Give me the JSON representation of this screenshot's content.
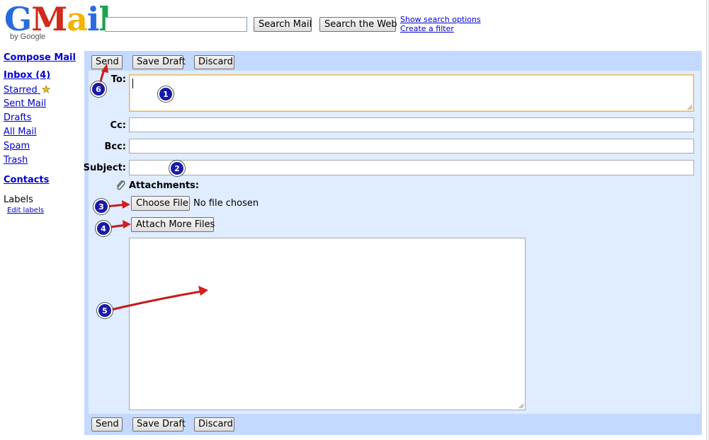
{
  "header": {
    "logo_text": "Gmail",
    "logo_byline": "by Google",
    "search_value": "",
    "search_mail_label": "Search Mail",
    "search_web_label": "Search the Web",
    "show_search_options": "Show search options",
    "create_filter": "Create a filter"
  },
  "nav": {
    "compose": "Compose Mail",
    "items": [
      {
        "label": "Inbox (4)"
      },
      {
        "label": "Starred"
      },
      {
        "label": "Sent Mail"
      },
      {
        "label": "Drafts"
      },
      {
        "label": "All Mail"
      },
      {
        "label": "Spam"
      },
      {
        "label": "Trash"
      }
    ],
    "contacts": "Contacts",
    "labels_heading": "Labels",
    "edit_labels": "Edit labels"
  },
  "compose": {
    "toolbar": {
      "send": "Send",
      "save_draft": "Save Draft",
      "discard": "Discard"
    },
    "fields": {
      "to_label": "To:",
      "cc_label": "Cc:",
      "bcc_label": "Bcc:",
      "subject_label": "Subject:",
      "to_value": "",
      "cc_value": "",
      "bcc_value": "",
      "subject_value": ""
    },
    "attachments": {
      "label": "Attachments:",
      "choose_file": "Choose File",
      "no_file": "No file chosen",
      "attach_more": "Attach More Files"
    },
    "body_value": ""
  },
  "annotations": {
    "markers": [
      "1",
      "2",
      "3",
      "4",
      "5",
      "6"
    ],
    "marker_color": "#1a1aa8",
    "arrow_color": "#d41c1c"
  },
  "colors": {
    "panel": "#c3d9ff",
    "panel_inner": "#e0ecff",
    "link": "#0000cc",
    "focus_border": "#e3b861"
  },
  "icons": {
    "star": "star-icon",
    "paperclip": "paperclip-icon"
  }
}
